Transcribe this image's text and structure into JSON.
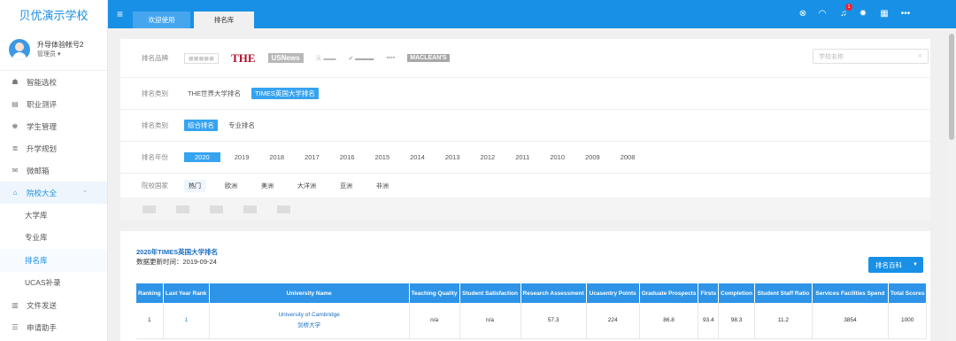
{
  "app": {
    "school_name": "贝优演示学校"
  },
  "user": {
    "name": "升导体验帐号2",
    "role": "管理员"
  },
  "sidebar": {
    "items": [
      {
        "label": "智能选校",
        "icon": "graduation-cap-icon",
        "glyph": "☗"
      },
      {
        "label": "职业测评",
        "icon": "clipboard-icon",
        "glyph": "▤"
      },
      {
        "label": "学生管理",
        "icon": "users-icon",
        "glyph": "♚"
      },
      {
        "label": "升学规划",
        "icon": "list-icon",
        "glyph": "≣"
      },
      {
        "label": "微邮箱",
        "icon": "mail-icon",
        "glyph": "✉"
      },
      {
        "label": "院校大全",
        "icon": "university-icon",
        "glyph": "⌂"
      }
    ],
    "sub_items": [
      "大学库",
      "专业库",
      "排名库",
      "UCAS补录"
    ],
    "bottom_items": [
      {
        "label": "文件发送",
        "icon": "file-send-icon",
        "glyph": "▥"
      },
      {
        "label": "申请助手",
        "icon": "menu-icon",
        "glyph": "☰"
      }
    ]
  },
  "topbar": {
    "tabs": [
      "欢迎使用",
      "排名库"
    ],
    "notification_count": "1"
  },
  "filters": {
    "brand_label": "排名品牌",
    "brands": [
      "THE",
      "USNews",
      "MACLEAN'S"
    ],
    "search_placeholder": "学校名称",
    "category_label": "排名类别",
    "categories": [
      "THE世界大学排名",
      "TIMES英国大学排名"
    ],
    "type_label": "排名类别",
    "types": [
      "综合排名",
      "专业排名"
    ],
    "year_label": "排名年份",
    "years": [
      "2020",
      "2019",
      "2018",
      "2017",
      "2016",
      "2015",
      "2014",
      "2013",
      "2012",
      "2011",
      "2010",
      "2009",
      "2008"
    ],
    "region_label": "院校国家",
    "regions": [
      "热门",
      "欧洲",
      "美洲",
      "大洋洲",
      "亚洲",
      "非洲"
    ]
  },
  "results": {
    "title": "2020年TIMES英国大学排名",
    "update": "数据更新时间：2019-09-24",
    "button": "排名百科",
    "columns": [
      "Ranking",
      "Last Year Rank",
      "University Name",
      "Teaching Quality",
      "Student Satisfaction",
      "Research Assessment",
      "Ucasentry Points",
      "Graduate Prospects",
      "Firsts",
      "Completion",
      "Student Staff Ratio",
      "Services Facilities Spend",
      "Total Scores"
    ],
    "rows": [
      {
        "ranking": "1",
        "last_year": "1",
        "name_en": "University of Cambridge",
        "name_cn": "剑桥大学",
        "teaching": "n/a",
        "satisfaction": "n/a",
        "research": "57.3",
        "ucas": "224",
        "prospects": "86.8",
        "firsts": "93.4",
        "completion": "98.3",
        "ratio": "11.2",
        "spend": "3854",
        "total": "1000"
      }
    ]
  }
}
